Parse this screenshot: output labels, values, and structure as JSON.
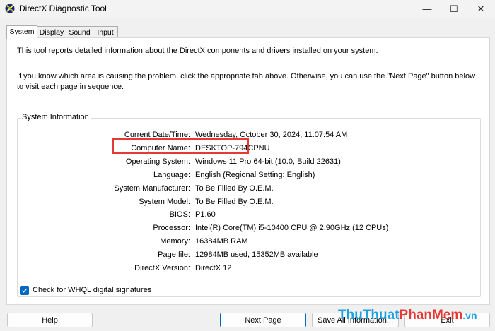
{
  "window": {
    "title": "DirectX Diagnostic Tool",
    "minimize": "—",
    "maximize": "☐",
    "close": "✕"
  },
  "tabs": [
    {
      "label": "System",
      "active": true
    },
    {
      "label": "Display",
      "active": false
    },
    {
      "label": "Sound",
      "active": false
    },
    {
      "label": "Input",
      "active": false
    }
  ],
  "description": {
    "line1": "This tool reports detailed information about the DirectX components and drivers installed on your system.",
    "line2": "If you know which area is causing the problem, click the appropriate tab above.  Otherwise, you can use the \"Next Page\" button below to visit each page in sequence."
  },
  "system_info": {
    "group_title": "System Information",
    "rows": [
      {
        "label": "Current Date/Time:",
        "value": "Wednesday, October 30, 2024, 11:07:54 AM"
      },
      {
        "label": "Computer Name:",
        "value": "DESKTOP-794CPNU"
      },
      {
        "label": "Operating System:",
        "value": "Windows 11 Pro 64-bit (10.0, Build 22631)"
      },
      {
        "label": "Language:",
        "value": "English (Regional Setting: English)"
      },
      {
        "label": "System Manufacturer:",
        "value": "To Be Filled By O.E.M."
      },
      {
        "label": "System Model:",
        "value": "To Be Filled By O.E.M."
      },
      {
        "label": "BIOS:",
        "value": "P1.60"
      },
      {
        "label": "Processor:",
        "value": "Intel(R) Core(TM) i5-10400 CPU @ 2.90GHz (12 CPUs)"
      },
      {
        "label": "Memory:",
        "value": "16384MB RAM"
      },
      {
        "label": "Page file:",
        "value": "12984MB used, 15352MB available"
      },
      {
        "label": "DirectX Version:",
        "value": "DirectX 12"
      }
    ],
    "highlight_color": "#e53935"
  },
  "whql": {
    "label": "Check for WHQL digital signatures",
    "checked": true
  },
  "buttons": {
    "help": "Help",
    "next_page": "Next Page",
    "save_all": "Save All Information...",
    "exit": "Exit"
  },
  "watermark": {
    "part1": "ThuThuat",
    "part2": "PhanMem",
    "part3": ".vn"
  },
  "colors": {
    "accent": "#0067c0",
    "highlight": "#e53935",
    "watermark_blue": "#1fa0e0"
  }
}
